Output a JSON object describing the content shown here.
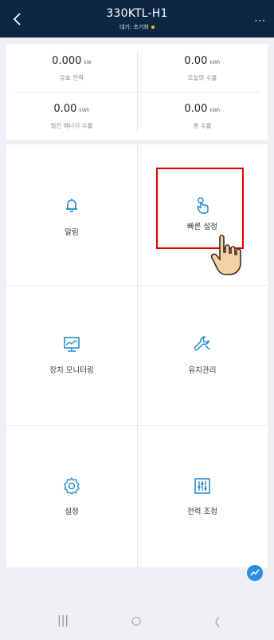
{
  "header": {
    "title": "330KTL-H1",
    "subtitle": "대기: 초기화",
    "more_label": "···"
  },
  "stats": [
    {
      "value": "0.000",
      "unit": "kW",
      "label": "유효 전력"
    },
    {
      "value": "0.00",
      "unit": "kWh",
      "label": "오늘의 수율"
    },
    {
      "value": "0.00",
      "unit": "kWh",
      "label": "월간 에너지 수율"
    },
    {
      "value": "0.00",
      "unit": "kWh",
      "label": "총 수율"
    }
  ],
  "menu": {
    "alarm": "알림",
    "quick_settings": "빠른 설정",
    "device_monitoring": "장치 모니터링",
    "maintenance": "유지관리",
    "settings": "설정",
    "power_adjustment": "전력 조정"
  },
  "colors": {
    "header_bg": "#0d2742",
    "accent": "#1e88c9",
    "highlight": "#e00000",
    "status_dot": "#f5c400"
  },
  "icons": [
    "back-arrow-icon",
    "bell-icon",
    "hand-tap-icon",
    "monitor-icon",
    "wrench-icon",
    "gear-icon",
    "sliders-icon",
    "chart-icon"
  ],
  "system_nav": {
    "recents": "|||",
    "home": "○",
    "back": "〈"
  }
}
